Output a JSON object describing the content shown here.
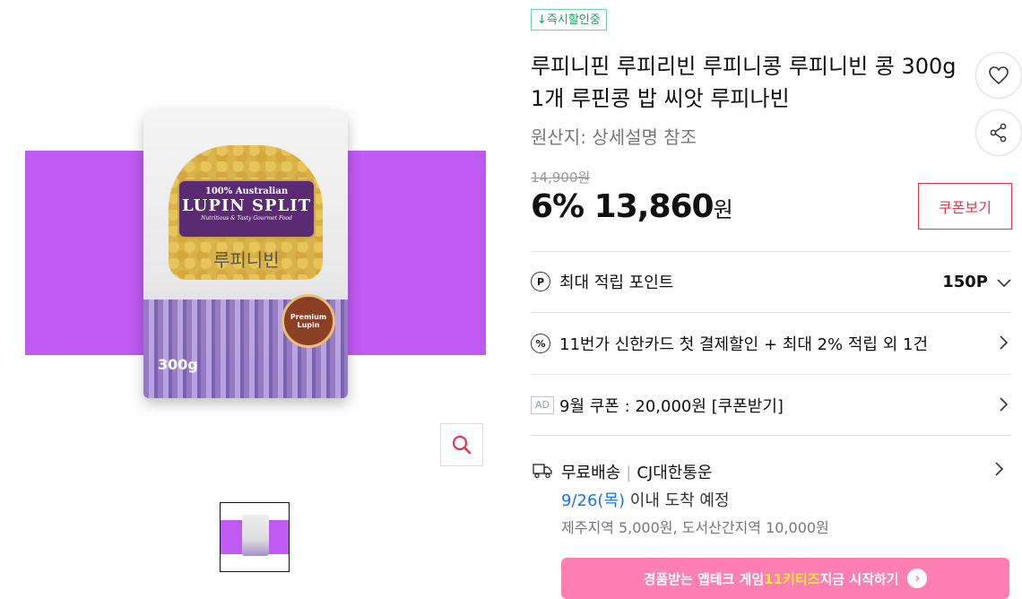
{
  "gallery": {
    "bag_badge_line1": "100% Australian",
    "bag_badge_line2": "LUPIN SPLIT",
    "bag_badge_line3": "Nutritious & Tasty Gourmet Food",
    "bag_korean_name": "루피니빈",
    "bag_weight": "300g",
    "bag_stamp": "Premium Lupin",
    "zoom_icon": "search-icon"
  },
  "product": {
    "instant_badge": "↓즉시할인중",
    "title": "루피니핀 루피리빈 루피니콩 루피니빈 콩 300g 1개 루핀콩 밥 씨앗 루피나빈",
    "origin": "원산지:  상세설명 참조",
    "original_price": "14,900원",
    "discount": "6%",
    "price": "13,860",
    "currency": "원",
    "coupon_button": "쿠폰보기",
    "like_icon": "heart-icon",
    "share_icon": "share-icon"
  },
  "benefits": {
    "points_label": "최대 적립 포인트",
    "points_value": "150P",
    "points_icon": "P",
    "card_label": "11번가 신한카드 첫 결제할인 + 최대 2% 적립 외 1건",
    "card_icon": "%",
    "ad_tag": "AD",
    "coupon_label": "9월 쿠폰 : 20,000원 [쿠폰받기]"
  },
  "shipping": {
    "type": "무료배송",
    "carrier": "CJ대한통운",
    "date": "9/26(목)",
    "date_suffix": " 이내 도착 예정",
    "extra": "제주지역 5,000원, 도서산간지역 10,000원"
  },
  "banner": {
    "text_pre": "경품받는 앱테크 게임 ",
    "text_hl": "11키티즈",
    "text_post": " 지금 시작하기",
    "go_icon": "›"
  },
  "colors": {
    "accent_red": "#e5354c",
    "instant_green": "#1a9e63",
    "image_band": "#bf5af2",
    "banner_pink": "#ff7fb3",
    "date_blue": "#1a73e8"
  }
}
